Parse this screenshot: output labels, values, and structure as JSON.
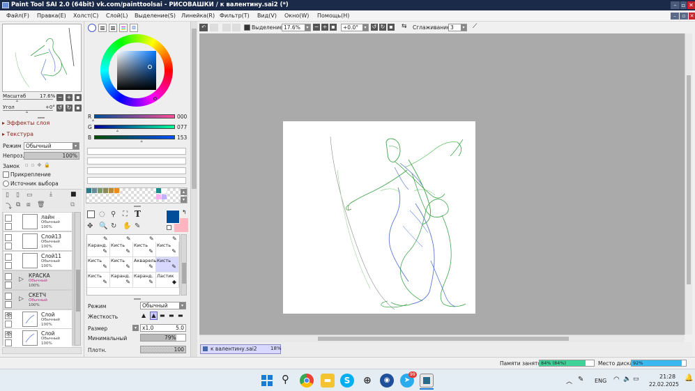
{
  "app": {
    "title": "Paint Tool SAI 2.0 (64bit) vk.com/painttoolsai - РИСОВАШКИ / к валентину.sai2 (*)",
    "win_min": "–",
    "win_max": "▫",
    "win_close": "✕"
  },
  "menu": [
    "Файл(F)",
    "Правка(E)",
    "Холст(C)",
    "Слой(L)",
    "Выделение(S)",
    "Линейка(R)",
    "Фильтр(T)",
    "Вид(V)",
    "Окно(W)",
    "Помощь(H)"
  ],
  "navigator": {
    "zoom_label": "Масштаб",
    "zoom_value": "17.6%",
    "angle_label": "Угол",
    "angle_value": "+0°"
  },
  "layer_props": {
    "effects": "▸ Эффекты слоя",
    "texture": "▸ Текстура",
    "mode_label": "Режим",
    "mode_value": "Обычный",
    "opacity_label": "Непроз.",
    "opacity_value": "100%",
    "lock_label": "Замок",
    "clip_label": "Прикрепление",
    "source_label": "Источник выбора"
  },
  "layers": [
    {
      "name": "лайн",
      "mode": "Обычный",
      "opacity": "100%",
      "visible": false,
      "folder": false
    },
    {
      "name": "Слой13",
      "mode": "Обычный",
      "opacity": "100%",
      "visible": false,
      "folder": false
    },
    {
      "name": "Слой11",
      "mode": "Обычный",
      "opacity": "100%",
      "visible": false,
      "folder": false
    },
    {
      "name": "КРАСКА",
      "mode": "Обычный",
      "opacity": "100%",
      "visible": false,
      "folder": true
    },
    {
      "name": "СКЕТЧ",
      "mode": "Обычный",
      "opacity": "100%",
      "visible": false,
      "folder": true
    },
    {
      "name": "Слой",
      "mode": "Обычный",
      "opacity": "100%",
      "visible": true,
      "folder": false
    },
    {
      "name": "Слой",
      "mode": "Обычный",
      "opacity": "100%",
      "visible": true,
      "folder": false
    }
  ],
  "color": {
    "r_label": "R",
    "r_value": "000",
    "g_label": "G",
    "g_value": "077",
    "b_label": "B",
    "b_value": "153",
    "r": 0,
    "g": 77,
    "b": 153,
    "primary": "#004d99",
    "secondary": "#ffb6c1",
    "swatches": [
      "#2a7a8a",
      "#6a8a9a",
      "#7a9a6a",
      "#8a8a5a",
      "#b88a3a",
      "#f08a1a"
    ],
    "swatches2": [
      "#1a8a8a",
      "#ffffff",
      "#ffb0f0",
      "#c0b0ff"
    ]
  },
  "tools": [
    {
      "label": "Каранд.",
      "selected": false
    },
    {
      "label": "Кисть",
      "selected": false
    },
    {
      "label": "Кисть",
      "selected": false
    },
    {
      "label": "Кисть",
      "selected": false
    },
    {
      "label": "Кисть",
      "selected": false
    },
    {
      "label": "Кисть",
      "selected": false
    },
    {
      "label": "Акварель",
      "selected": false
    },
    {
      "label": "Кисть",
      "selected": true
    },
    {
      "label": "Кисть",
      "selected": false
    },
    {
      "label": "Каранд.",
      "selected": false
    },
    {
      "label": "Каранд.",
      "selected": false
    },
    {
      "label": "Ластик",
      "selected": false
    }
  ],
  "brush": {
    "mode_label": "Режим",
    "mode_value": "Обычный",
    "hardness_label": "Жесткость",
    "size_label": "Размер",
    "size_mult": "x1.0",
    "size_value": "5.0",
    "min_label": "Минимальный",
    "min_value": "79%",
    "min_level": 0.79,
    "density_label": "Плотн.",
    "density_value": "100"
  },
  "canvas_toolbar": {
    "selection_label": "Выделение",
    "zoom_value": "17.6%",
    "angle_value": "+0.0°",
    "smoothing_label": "Сглаживание",
    "smoothing_value": "3"
  },
  "doc_tab": {
    "name": "к валентину.sai2",
    "zoom": "18%"
  },
  "status": {
    "memory_label": "Памяти занято",
    "memory_value": "84% (84%)",
    "memory_level": 0.84,
    "disk_label": "Место диска",
    "disk_value": "92%",
    "disk_level": 0.92
  },
  "taskbar": {
    "lang": "ENG",
    "time": "21:28",
    "date": "22.02.2025",
    "telegram_badge": "99"
  }
}
